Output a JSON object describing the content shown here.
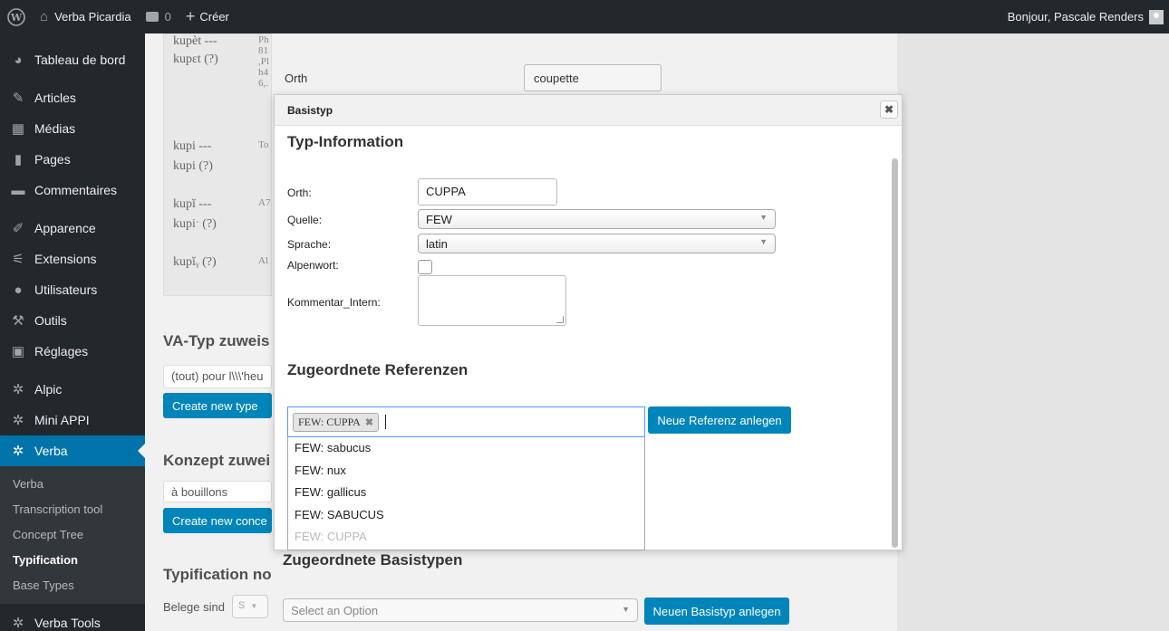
{
  "adminbar": {
    "site_name": "Verba Picardia",
    "comment_count": "0",
    "create_label": "Créer",
    "greeting": "Bonjour, Pascale Renders"
  },
  "sidebar": {
    "items": [
      {
        "label": "Tableau de bord",
        "icon": "dashboard-icon"
      },
      {
        "label": "Articles",
        "icon": "pin-icon"
      },
      {
        "label": "Médias",
        "icon": "media-icon"
      },
      {
        "label": "Pages",
        "icon": "page-icon"
      },
      {
        "label": "Commentaires",
        "icon": "comment-icon"
      },
      {
        "label": "Apparence",
        "icon": "brush-icon"
      },
      {
        "label": "Extensions",
        "icon": "plugin-icon"
      },
      {
        "label": "Utilisateurs",
        "icon": "user-icon"
      },
      {
        "label": "Outils",
        "icon": "wrench-icon"
      },
      {
        "label": "Réglages",
        "icon": "settings-icon"
      },
      {
        "label": "Alpic",
        "icon": "gear-icon"
      },
      {
        "label": "Mini APPI",
        "icon": "gear-icon"
      },
      {
        "label": "Verba",
        "icon": "gear-icon"
      }
    ],
    "submenu": [
      "Verba",
      "Transcription tool",
      "Concept Tree",
      "Typification",
      "Base Types"
    ],
    "last_item": "Verba Tools",
    "accent": "#0073aa"
  },
  "page": {
    "typ_rows": [
      {
        "a": "kupèt ---",
        "b": "kupεt (?)",
        "extra": [
          "Ph",
          "81",
          ",Pl",
          "h4",
          "6,."
        ]
      },
      {
        "a": "kupi ---",
        "b": "kupi (?)",
        "extra": [
          "To"
        ]
      },
      {
        "a": "kupĭ ---",
        "b": "kupiˑ (?)",
        "extra": [
          "A7"
        ]
      },
      {
        "a": "kupĭᵧ (?)",
        "b": "",
        "extra": [
          "Al"
        ]
      }
    ],
    "orth_label": "Orth",
    "orth_value": "coupette",
    "va_heading": "VA-Typ zuweis",
    "va_select": "(tout) pour l\\\\\\'heu",
    "va_button": "Create new type",
    "konzept_heading": "Konzept zuwei",
    "konzept_select": "à bouillons",
    "konzept_button": "Create new conce",
    "typification_heading": "Typification no",
    "belege_label": "Belege sind",
    "belege_select": "S",
    "zug_basistypen_heading": "Zugeordnete Basistypen",
    "basistyp_select": "Select an Option",
    "neuen_basistyp_button": "Neuen Basistyp anlegen"
  },
  "dialog": {
    "title": "Basistyp",
    "heading": "Typ-Information",
    "orth_label": "Orth:",
    "orth_value": "CUPPA",
    "quelle_label": "Quelle:",
    "quelle_value": "FEW",
    "sprache_label": "Sprache:",
    "sprache_value": "latin",
    "alpenwort_label": "Alpenwort:",
    "kommentar_label": "Kommentar_Intern:",
    "referenzen_heading": "Zugeordnete Referenzen",
    "tag": "FEW: CUPPA",
    "neue_referenz_button": "Neue Referenz anlegen",
    "dropdown_options": [
      "FEW: sabucus",
      "FEW: nux",
      "FEW: gallicus",
      "FEW: SABUCUS",
      "FEW: CUPPA"
    ]
  }
}
